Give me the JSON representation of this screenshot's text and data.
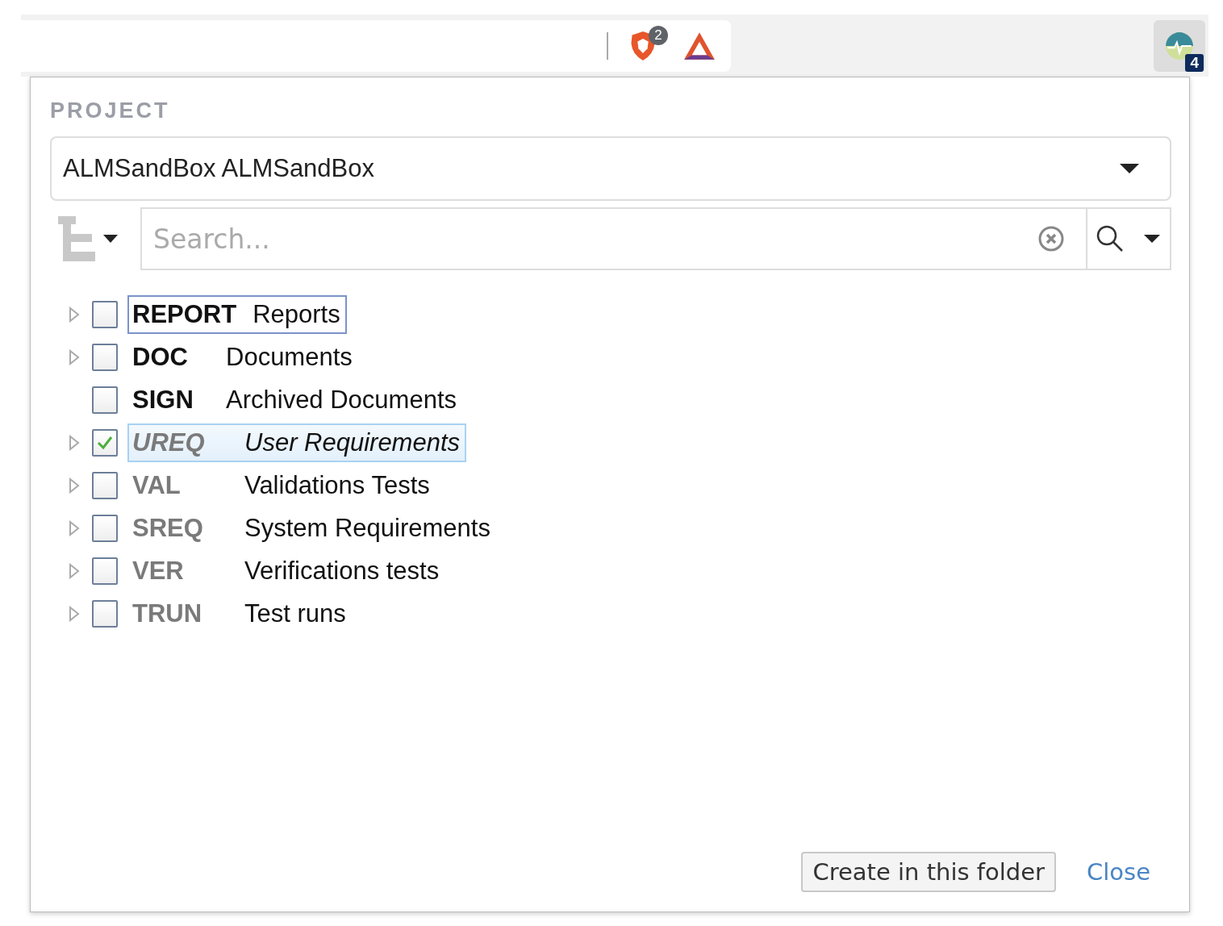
{
  "toolbar": {
    "shield_badge": "2",
    "extension_badge": "4"
  },
  "project": {
    "label": "PROJECT",
    "value": "ALMSandBox ALMSandBox"
  },
  "search": {
    "placeholder": "Search..."
  },
  "tree": [
    {
      "code": "REPORT",
      "name": "Reports",
      "expandable": true,
      "checked": false,
      "selected": false,
      "focused": true,
      "dimmed": false
    },
    {
      "code": "DOC",
      "name": "Documents",
      "expandable": true,
      "checked": false,
      "selected": false,
      "focused": false,
      "dimmed": false
    },
    {
      "code": "SIGN",
      "name": "Archived Documents",
      "expandable": false,
      "checked": false,
      "selected": false,
      "focused": false,
      "dimmed": false
    },
    {
      "code": "UREQ",
      "name": "User Requirements",
      "expandable": true,
      "checked": true,
      "selected": true,
      "focused": false,
      "dimmed": true
    },
    {
      "code": "VAL",
      "name": "Validations Tests",
      "expandable": true,
      "checked": false,
      "selected": false,
      "focused": false,
      "dimmed": true
    },
    {
      "code": "SREQ",
      "name": "System Requirements",
      "expandable": true,
      "checked": false,
      "selected": false,
      "focused": false,
      "dimmed": true
    },
    {
      "code": "VER",
      "name": "Verifications tests",
      "expandable": true,
      "checked": false,
      "selected": false,
      "focused": false,
      "dimmed": true
    },
    {
      "code": "TRUN",
      "name": "Test runs",
      "expandable": true,
      "checked": false,
      "selected": false,
      "focused": false,
      "dimmed": true
    }
  ],
  "buttons": {
    "create": "Create in this folder",
    "close": "Close"
  }
}
